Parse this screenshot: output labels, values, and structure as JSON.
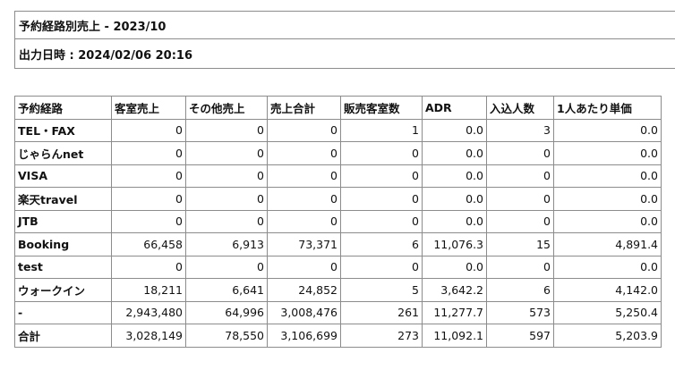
{
  "report": {
    "title": "予約経路別売上 - 2023/10",
    "output_datetime": "出力日時 : 2024/02/06 20:16"
  },
  "table": {
    "headers": [
      "予約経路",
      "客室売上",
      "その他売上",
      "売上合計",
      "販売客室数",
      "ADR",
      "入込人数",
      "1人あたり単価"
    ],
    "rows": [
      [
        "TEL・FAX",
        "0",
        "0",
        "0",
        "1",
        "0.0",
        "3",
        "0.0"
      ],
      [
        "じゃらんnet",
        "0",
        "0",
        "0",
        "0",
        "0.0",
        "0",
        "0.0"
      ],
      [
        "VISA",
        "0",
        "0",
        "0",
        "0",
        "0.0",
        "0",
        "0.0"
      ],
      [
        "楽天travel",
        "0",
        "0",
        "0",
        "0",
        "0.0",
        "0",
        "0.0"
      ],
      [
        "JTB",
        "0",
        "0",
        "0",
        "0",
        "0.0",
        "0",
        "0.0"
      ],
      [
        "Booking",
        "66,458",
        "6,913",
        "73,371",
        "6",
        "11,076.3",
        "15",
        "4,891.4"
      ],
      [
        "test",
        "0",
        "0",
        "0",
        "0",
        "0.0",
        "0",
        "0.0"
      ],
      [
        "ウォークイン",
        "18,211",
        "6,641",
        "24,852",
        "5",
        "3,642.2",
        "6",
        "4,142.0"
      ],
      [
        "-",
        "2,943,480",
        "64,996",
        "3,008,476",
        "261",
        "11,277.7",
        "573",
        "5,250.4"
      ],
      [
        "合計",
        "3,028,149",
        "78,550",
        "3,106,699",
        "273",
        "11,092.1",
        "597",
        "5,203.9"
      ]
    ]
  }
}
